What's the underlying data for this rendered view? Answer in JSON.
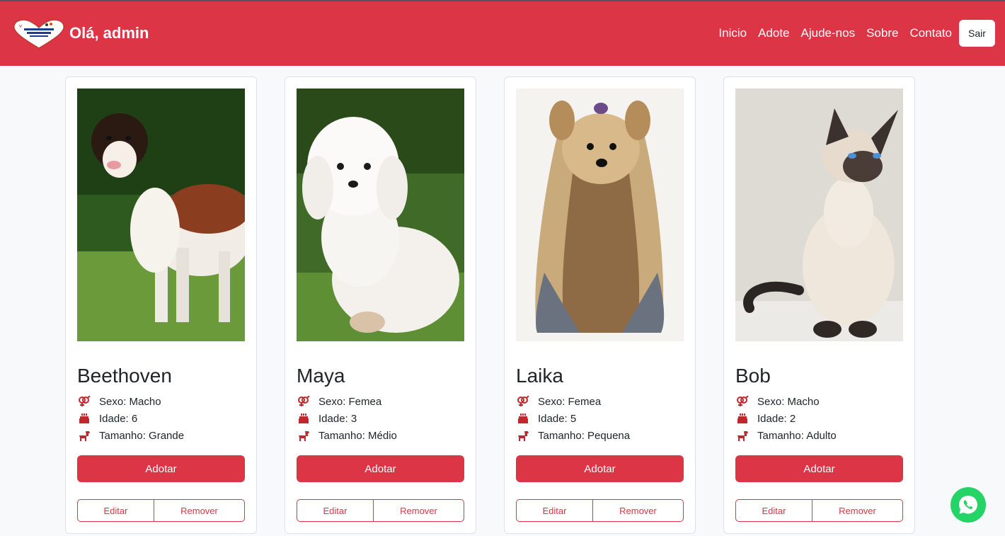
{
  "header": {
    "greeting": "Olá, admin",
    "nav": [
      "Inicio",
      "Adote",
      "Ajude-nos",
      "Sobre",
      "Contato"
    ],
    "logout_label": "Sair",
    "accent_color": "#dc3545"
  },
  "icons": {
    "sex": "gender-icon",
    "age": "birthday-cake-icon",
    "size": "dog-icon",
    "chat": "whatsapp-icon"
  },
  "pets": [
    {
      "name": "Beethoven",
      "sexo": "Sexo: Macho",
      "idade": "Idade: 6",
      "tamanho": "Tamanho: Grande"
    },
    {
      "name": "Maya",
      "sexo": "Sexo: Femea",
      "idade": "Idade: 3",
      "tamanho": "Tamanho: Médio"
    },
    {
      "name": "Laika",
      "sexo": "Sexo: Femea",
      "idade": "Idade: 5",
      "tamanho": "Tamanho: Pequena"
    },
    {
      "name": "Bob",
      "sexo": "Sexo: Macho",
      "idade": "Idade: 2",
      "tamanho": "Tamanho: Adulto"
    }
  ],
  "actions": {
    "adopt_label": "Adotar",
    "edit_label": "Editar",
    "remove_label": "Remover"
  }
}
